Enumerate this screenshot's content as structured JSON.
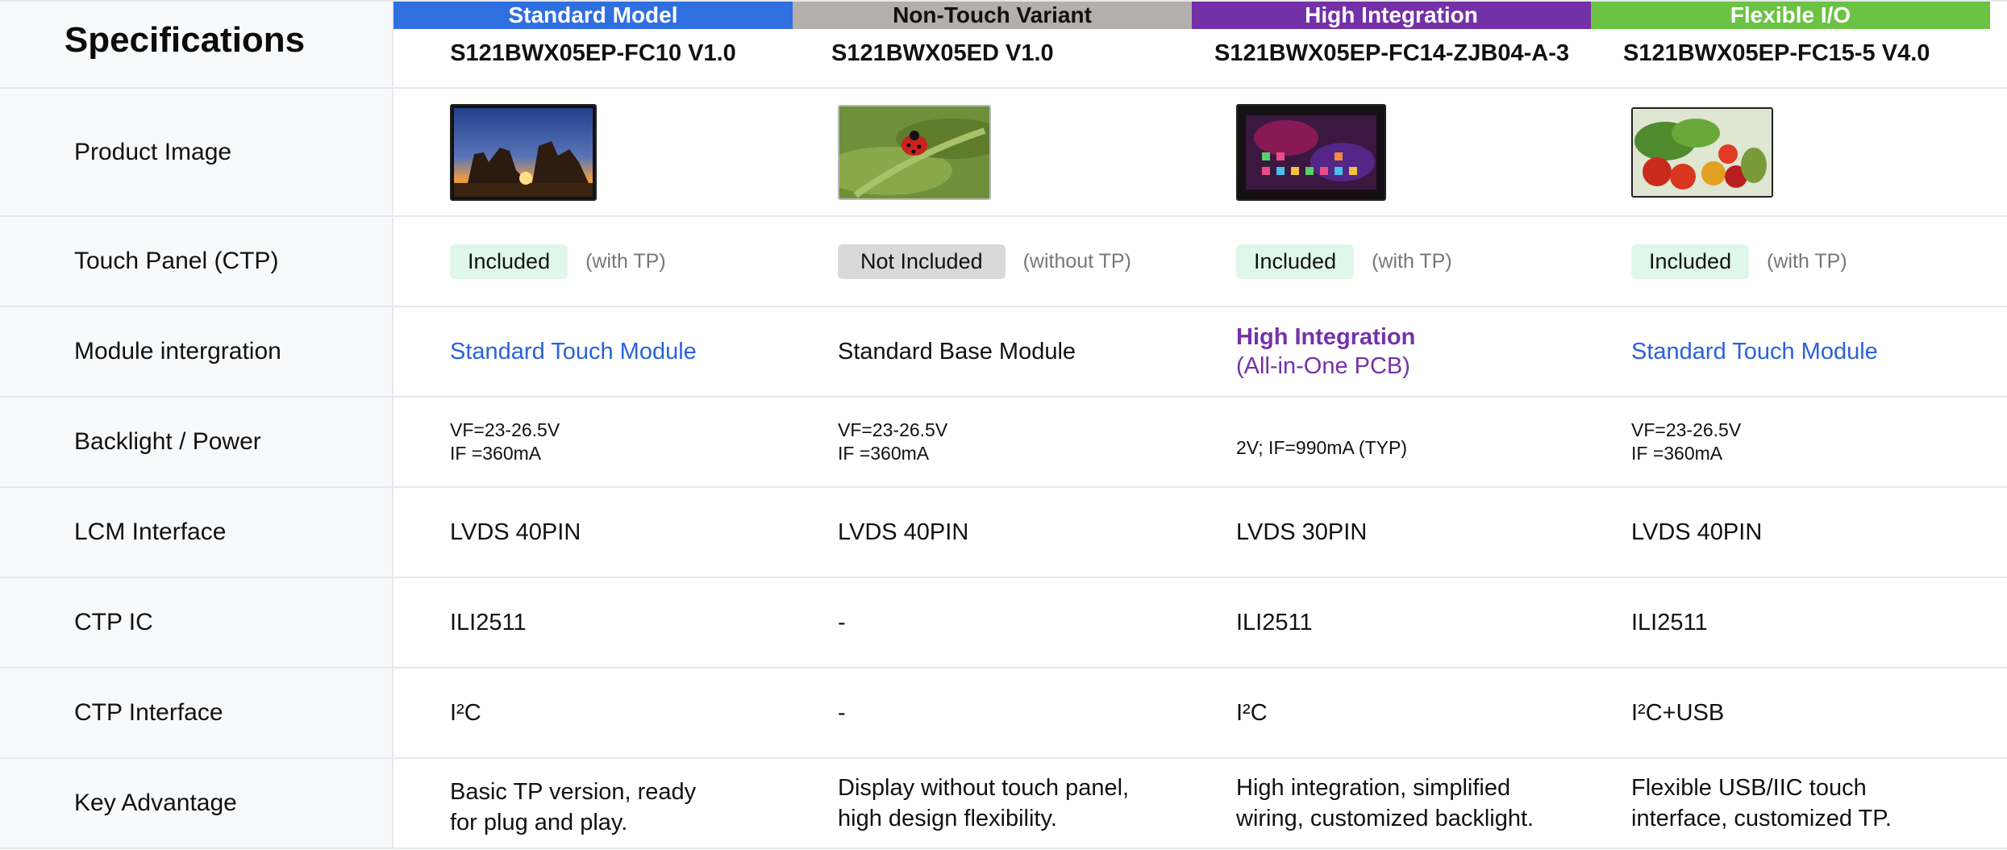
{
  "corner_title": "Specifications",
  "variants": [
    {
      "badge": "Standard Model",
      "badge_color": "#2f6fe0",
      "model": "S121BWX05EP-FC10 V1.0"
    },
    {
      "badge": "Non-Touch Variant",
      "badge_color": "#b4aeac",
      "badge_text_color": "#111111",
      "model": "S121BWX05ED V1.0"
    },
    {
      "badge": "High Integration",
      "badge_color": "#7430a6",
      "model": "S121BWX05EP-FC14-ZJB04-A-3"
    },
    {
      "badge": "Flexible I/O",
      "badge_color": "#6bc244",
      "model": "S121BWX05EP-FC15-5 V4.0"
    }
  ],
  "rows": {
    "product_image": {
      "label": "Product Image"
    },
    "touch_panel": {
      "label": "Touch Panel (CTP)",
      "values": [
        {
          "status": "Included",
          "note": "(with TP)"
        },
        {
          "status": "Not Included",
          "note": "(without TP)"
        },
        {
          "status": "Included",
          "note": "(with TP)"
        },
        {
          "status": "Included",
          "note": "(with TP)"
        }
      ]
    },
    "module": {
      "label": "Module intergration",
      "values": [
        "Standard Touch Module",
        "Standard Base Module",
        "High Integration",
        "Standard Touch Module"
      ],
      "sub": "(All-in-One PCB)"
    },
    "backlight": {
      "label": "Backlight / Power",
      "values": [
        {
          "l1": "VF=23-26.5V",
          "l2": "IF =360mA"
        },
        {
          "l1": "VF=23-26.5V",
          "l2": "IF =360mA"
        },
        {
          "l1": "2V; IF=990mA (TYP)",
          "l2": ""
        },
        {
          "l1": "VF=23-26.5V",
          "l2": "IF =360mA"
        }
      ]
    },
    "lcm": {
      "label": "LCM Interface",
      "values": [
        "LVDS 40PIN",
        "LVDS 40PIN",
        "LVDS 30PIN",
        "LVDS 40PIN"
      ]
    },
    "ctp_ic": {
      "label": "CTP IC",
      "values": [
        "ILI2511",
        "-",
        "ILI2511",
        "ILI2511"
      ]
    },
    "ctp_if": {
      "label": "CTP Interface",
      "values": [
        "I²C",
        "-",
        "I²C",
        "I²C+USB"
      ]
    },
    "advantage": {
      "label": "Key Advantage",
      "values": [
        {
          "l1": "Basic TP version, ready",
          "l2": "for plug and play."
        },
        {
          "l1": "Display without touch panel,",
          "l2": "high design flexibility."
        },
        {
          "l1": "High integration, simplified",
          "l2": "wiring, customized backlight."
        },
        {
          "l1": "Flexible USB/IIC touch",
          "l2": "interface, customized TP."
        }
      ]
    }
  },
  "image_icons": [
    "sunset-rocks-icon",
    "ladybug-leaf-icon",
    "app-grid-screen-icon",
    "vegetables-icon"
  ]
}
